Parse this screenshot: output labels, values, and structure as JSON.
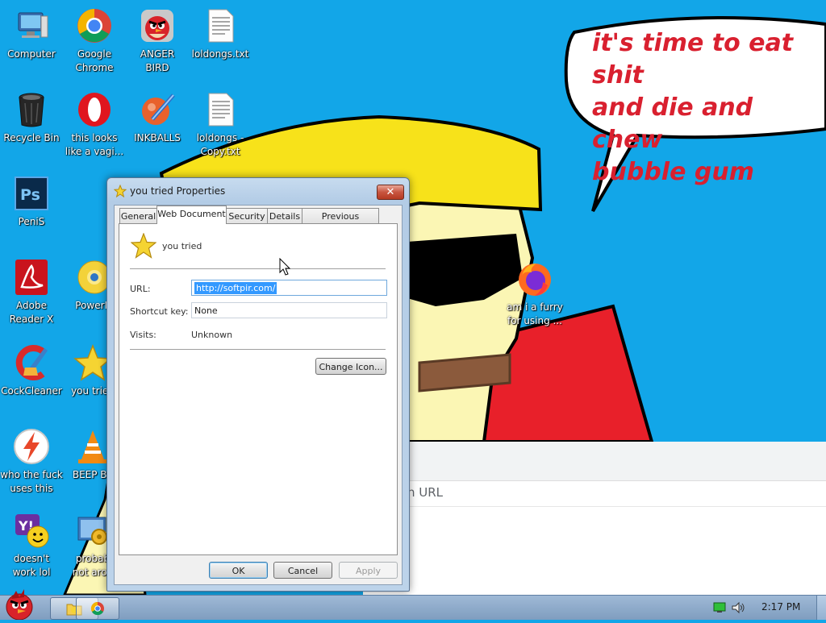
{
  "desktop": {
    "icons": [
      {
        "label": "Computer",
        "icon": "computer-icon"
      },
      {
        "label": "Google\nChrome",
        "icon": "chrome-icon"
      },
      {
        "label": "ANGER\nBIRD",
        "icon": "angry-bird-icon"
      },
      {
        "label": "loldongs.txt",
        "icon": "text-file-icon"
      },
      {
        "label": "Recycle Bin",
        "icon": "recycle-bin-icon"
      },
      {
        "label": "this looks\nlike a vagi...",
        "icon": "opera-icon"
      },
      {
        "label": "INKBALLS",
        "icon": "inkball-icon"
      },
      {
        "label": "loldongs -\nCopy.txt",
        "icon": "text-file-icon"
      },
      {
        "label": "PeniS",
        "icon": "photoshop-icon"
      },
      {
        "label": "Adobe\nReader X",
        "icon": "adobe-reader-icon"
      },
      {
        "label": "PowerIS",
        "icon": "disc-icon"
      },
      {
        "label": "CockCleaner",
        "icon": "ccleaner-icon"
      },
      {
        "label": "you tried",
        "icon": "star-icon"
      },
      {
        "label": "who the fuck\nuses this",
        "icon": "lightning-icon"
      },
      {
        "label": "BEEP BE",
        "icon": "vlc-icon"
      },
      {
        "label": "doesn't\nwork lol",
        "icon": "yahoo-icon"
      },
      {
        "label": "probab\nnot arou",
        "icon": "settings-icon"
      },
      {
        "label": "am i a furry\nfor using ...",
        "icon": "firefox-icon"
      }
    ],
    "bubble_text": "it's time to eat shit\nand die and chew\nbubble gum",
    "browser_url_hint": "n URL"
  },
  "dialog": {
    "title": "you tried Properties",
    "close_label": "✕",
    "tabs": [
      "General",
      "Web Document",
      "Security",
      "Details",
      "Previous Versions"
    ],
    "active_tab": "Web Document",
    "name": "you tried",
    "url_label": "URL:",
    "url_value": "http://softpir.com/",
    "shortcut_label": "Shortcut key:",
    "shortcut_value": "None",
    "visits_label": "Visits:",
    "visits_value": "Unknown",
    "change_icon_label": "Change Icon...",
    "ok_label": "OK",
    "cancel_label": "Cancel",
    "apply_label": "Apply"
  },
  "taskbar": {
    "clock": "2:17 PM"
  },
  "colors": {
    "wallpaper_sky": "#12a6e8",
    "bubble_text": "#d9202f",
    "hat_yellow": "#f7e21a",
    "skin": "#fbf6b4",
    "shirt_red": "#e8202a"
  }
}
